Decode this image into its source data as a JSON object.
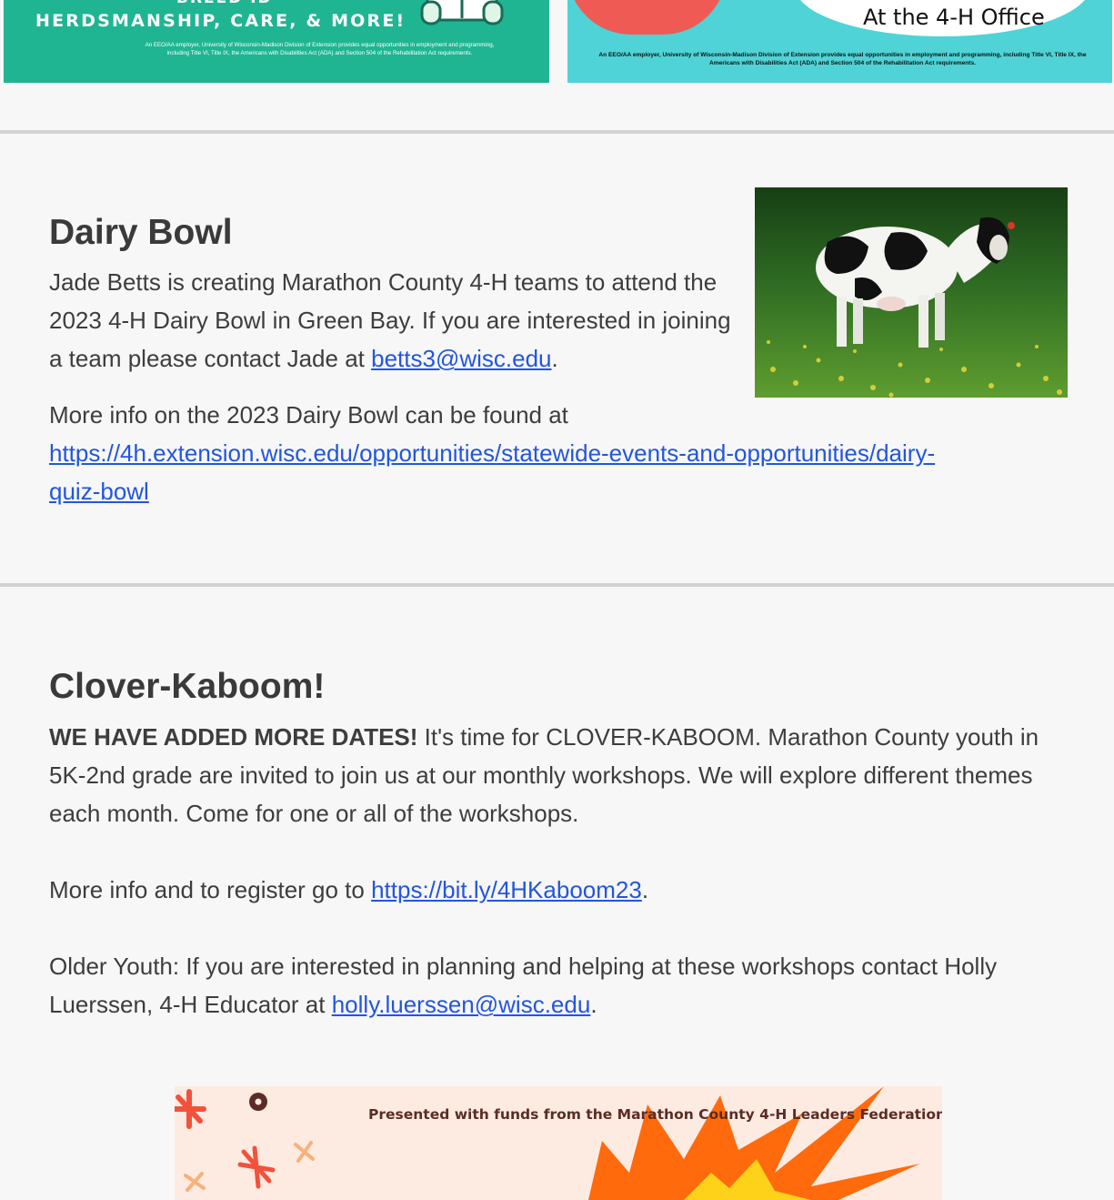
{
  "banners": {
    "left": {
      "breed_text": "BREED ID",
      "headline": "HERDSMANSHIP, CARE, & MORE!",
      "eeo": "An EEO/AA employer, University of Wisconsin-Madison Division of Extension provides equal opportunities in employment and programming, including Title VI, Title IX, the Americans with Disabilities Act (ADA) and Section 504 of the Rehabilitation Act requirements."
    },
    "right": {
      "office_text": "At the 4-H Office",
      "eeo": "An EEO/AA employer, University of Wisconsin-Madison Division of Extension provides equal opportunities in employment and programming, including Title VI, Title IX, the Americans with Disabilities Act (ADA) and Section 504 of the Rehabilitation Act requirements."
    }
  },
  "dairy_bowl": {
    "title": "Dairy Bowl",
    "intro": "Jade Betts is creating Marathon County 4-H teams to attend the 2023 4-H Dairy Bowl in Green Bay. If you are interested in joining a team please contact Jade at ",
    "email": "betts3@wisc.edu",
    "intro_end": ".",
    "more_info": "More info on the 2023 Dairy Bowl can be found at",
    "url_line1": "https://4h.extension.wisc.edu/opportunities/statewide-events-and-opportunities/dairy-",
    "url_line2": "quiz-bowl"
  },
  "clover_kaboom": {
    "title": "Clover-Kaboom!",
    "bold_lead": "WE HAVE ADDED MORE DATES!",
    "intro": " It's time for CLOVER-KABOOM. Marathon County youth in 5K-2nd grade are invited to join us at our monthly workshops. We will explore different themes each month. Come for one or all of the workshops.",
    "register_prefix": "More info and to register go to ",
    "register_link": "https://bit.ly/4HKaboom23",
    "register_end": ".",
    "older_prefix": "Older Youth:  If you are interested in planning and helping at these workshops contact Holly Luerssen, 4-H Educator at ",
    "older_email": "holly.luerssen@wisc.edu",
    "older_end": "."
  },
  "flyer": {
    "caption": "Presented with funds from the Marathon County 4-H Leaders Federation"
  },
  "colors": {
    "link": "#2255e0",
    "divider": "#d2d2d2",
    "banner_left": "#1fb592",
    "banner_right": "#4fd3d6",
    "kaboom_orange": "#ff6a0d"
  }
}
